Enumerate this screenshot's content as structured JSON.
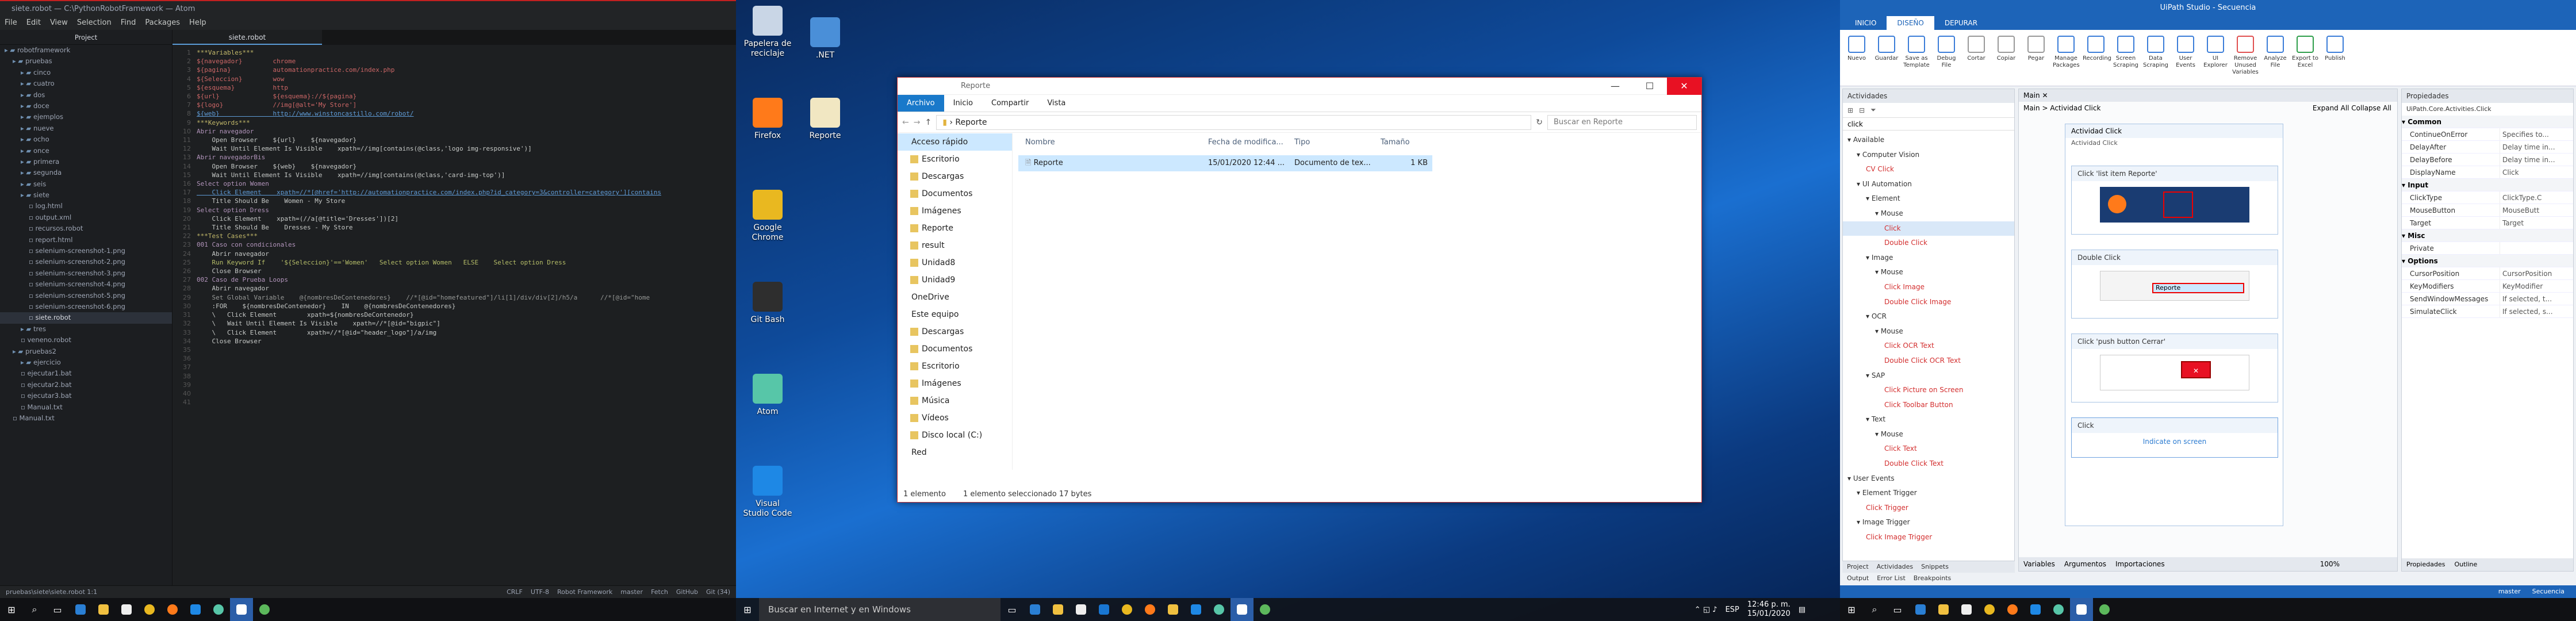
{
  "atom": {
    "title": "siete.robot — C:\\PythonRobotFramework — Atom",
    "menu": [
      "File",
      "Edit",
      "View",
      "Selection",
      "Find",
      "Packages",
      "Help"
    ],
    "project_header": "Project",
    "tab": "siete.robot",
    "tree": [
      {
        "t": "robotframework",
        "d": 0
      },
      {
        "t": "pruebas",
        "d": 1
      },
      {
        "t": "cinco",
        "d": 2
      },
      {
        "t": "cuatro",
        "d": 2
      },
      {
        "t": "dos",
        "d": 2
      },
      {
        "t": "doce",
        "d": 2
      },
      {
        "t": "ejemplos",
        "d": 2
      },
      {
        "t": "nueve",
        "d": 2
      },
      {
        "t": "ocho",
        "d": 2
      },
      {
        "t": "once",
        "d": 2
      },
      {
        "t": "primera",
        "d": 2
      },
      {
        "t": "segunda",
        "d": 2
      },
      {
        "t": "seis",
        "d": 2
      },
      {
        "t": "siete",
        "d": 2
      },
      {
        "t": "log.html",
        "d": 3
      },
      {
        "t": "output.xml",
        "d": 3
      },
      {
        "t": "recursos.robot",
        "d": 3
      },
      {
        "t": "report.html",
        "d": 3
      },
      {
        "t": "selenium-screenshot-1.png",
        "d": 3
      },
      {
        "t": "selenium-screenshot-2.png",
        "d": 3
      },
      {
        "t": "selenium-screenshot-3.png",
        "d": 3
      },
      {
        "t": "selenium-screenshot-4.png",
        "d": 3
      },
      {
        "t": "selenium-screenshot-5.png",
        "d": 3
      },
      {
        "t": "selenium-screenshot-6.png",
        "d": 3
      },
      {
        "t": "siete.robot",
        "d": 3,
        "sel": true
      },
      {
        "t": "tres",
        "d": 2
      },
      {
        "t": "veneno.robot",
        "d": 2
      },
      {
        "t": "pruebas2",
        "d": 1
      },
      {
        "t": "ejercicio",
        "d": 2
      },
      {
        "t": "ejecutar1.bat",
        "d": 2
      },
      {
        "t": "ejecutar2.bat",
        "d": 2
      },
      {
        "t": "ejecutar3.bat",
        "d": 2
      },
      {
        "t": "Manual.txt",
        "d": 2
      },
      {
        "t": "Manual.txt",
        "d": 1
      }
    ],
    "code": [
      [
        "sec",
        "***Variables***"
      ],
      [
        "var",
        "${navegador}        chrome"
      ],
      [
        "var",
        "${pagina}           automationpractice.com/index.php"
      ],
      [
        "var",
        "${Seleccion}        wow"
      ],
      [
        "var",
        "${esquema}          http"
      ],
      [
        "var",
        "${url}              ${esquema}://${pagina}"
      ],
      [
        "var",
        "${logo}             //img[@alt='My Store']"
      ],
      [
        "url",
        "${web}              http://www.winstoncastillo.com/robot/"
      ],
      [
        "",
        ""
      ],
      [
        "sec",
        "***Keywords***"
      ],
      [
        "kw",
        "Abrir navegador"
      ],
      [
        "",
        "    Open Browser    ${url}    ${navegador}"
      ],
      [
        "",
        "    Wait Until Element Is Visible    xpath=//img[contains(@class,'logo img-responsive')]"
      ],
      [
        "",
        ""
      ],
      [
        "kw",
        "Abrir navegadorBis"
      ],
      [
        "",
        "    Open Browser    ${web}    ${navegador}"
      ],
      [
        "",
        "    Wait Until Element Is Visible    xpath=//img[contains(@class,'card-img-top')]"
      ],
      [
        "",
        ""
      ],
      [
        "kw",
        "Select option Women"
      ],
      [
        "url",
        "    Click Element    xpath=//*[@href='http://automationpractice.com/index.php?id_category=3&controller=category'][contains"
      ],
      [
        "",
        "    Title Should Be    Women - My Store"
      ],
      [
        "",
        ""
      ],
      [
        "kw",
        "Select option Dress"
      ],
      [
        "",
        "    Click Element    xpath=(//a[@title='Dresses'])[2]"
      ],
      [
        "",
        "    Title Should Be    Dresses - My Store"
      ],
      [
        "",
        ""
      ],
      [
        "",
        ""
      ],
      [
        "sec",
        "***Test Cases***"
      ],
      [
        "kw",
        "001 Caso con condicionales"
      ],
      [
        "",
        "    Abrir navegador"
      ],
      [
        "str",
        "    Run Keyword If    '${Seleccion}'=='Women'   Select option Women   ELSE    Select option Dress"
      ],
      [
        "",
        "    Close Browser"
      ],
      [
        "",
        ""
      ],
      [
        "kw",
        "002 Caso de Prueba Loops"
      ],
      [
        "",
        "    Abrir navegador"
      ],
      [
        "cm",
        "    Set Global Variable    @{nombresDeContenedores}    //*[@id=\"homefeatured\"]/li[1]/div/div[2]/h5/a      //*[@id=\"home"
      ],
      [
        "",
        "    :FOR    ${nombresDeContenedor}    IN    @{nombresDeContenedores}"
      ],
      [
        "",
        "    \\   Click Element        xpath=${nombresDeContenedor}"
      ],
      [
        "",
        "    \\   Wait Until Element Is Visible    xpath=//*[@id=\"bigpic\"]"
      ],
      [
        "",
        "    \\   Click Element        xpath=//*[@id=\"header_logo\"]/a/img"
      ],
      [
        "",
        "    Close Browser"
      ]
    ],
    "status_left": "pruebas\\siete\\siete.robot   1:1",
    "status_right": [
      "CRLF",
      "UTF-8",
      "Robot Framework",
      "master",
      "Fetch",
      "GitHub",
      "Git (34)"
    ]
  },
  "desktop_icons": [
    {
      "label": "Papelera de reciclaje",
      "color": "#c9d6e6"
    },
    {
      "label": ".NET",
      "color": "#4a8fd8"
    },
    {
      "label": "Firefox",
      "color": "#ff7a1a"
    },
    {
      "label": "Reporte",
      "color": "#f1e7c2"
    },
    {
      "label": "Google Chrome",
      "color": "#e9b820"
    },
    {
      "label": "Git Bash",
      "color": "#2e2e2e"
    },
    {
      "label": "Atom",
      "color": "#57c6a8"
    },
    {
      "label": "Visual Studio Code",
      "color": "#1e88e5"
    }
  ],
  "explorer": {
    "title": "Reporte",
    "ribbon": [
      "Archivo",
      "Inicio",
      "Compartir",
      "Vista"
    ],
    "path": "Reporte",
    "search": "Buscar en Reporte",
    "nav": [
      {
        "t": "Acceso rápido",
        "h": true,
        "s": true
      },
      {
        "t": "Escritorio"
      },
      {
        "t": "Descargas"
      },
      {
        "t": "Documentos"
      },
      {
        "t": "Imágenes"
      },
      {
        "t": "Reporte"
      },
      {
        "t": "result"
      },
      {
        "t": "Unidad8"
      },
      {
        "t": "Unidad9"
      },
      {
        "t": "OneDrive",
        "h": true
      },
      {
        "t": "Este equipo",
        "h": true
      },
      {
        "t": "Descargas"
      },
      {
        "t": "Documentos"
      },
      {
        "t": "Escritorio"
      },
      {
        "t": "Imágenes"
      },
      {
        "t": "Música"
      },
      {
        "t": "Vídeos"
      },
      {
        "t": "Disco local (C:)"
      },
      {
        "t": "Red",
        "h": true
      }
    ],
    "columns": [
      "Nombre",
      "Fecha de modifica...",
      "Tipo",
      "Tamaño"
    ],
    "file": {
      "name": "Reporte",
      "date": "15/01/2020 12:44 ...",
      "type": "Documento de tex...",
      "size": "1 KB"
    },
    "status": [
      "1 elemento",
      "1 elemento seleccionado  17 bytes"
    ]
  },
  "taskbar2": {
    "search": "Buscar en Internet y en Windows",
    "lang": "ESP",
    "time": "12:46 p. m.",
    "date": "15/01/2020"
  },
  "uipath": {
    "title": "UiPath Studio - Secuencia",
    "tabs": [
      "INICIO",
      "DISEÑO",
      "DEPURAR"
    ],
    "ribbon": [
      "Nuevo",
      "Guardar",
      "Save as Template",
      "Debug File",
      "Cortar",
      "Copiar",
      "Pegar",
      "Manage Packages",
      "Recording",
      "Screen Scraping",
      "Data Scraping",
      "User Events",
      "UI Explorer",
      "Remove Unused Variables",
      "Analyze File",
      "Export to Excel",
      "Publish"
    ],
    "activities_header": "Actividades",
    "search": "click",
    "activities": [
      {
        "t": "Available",
        "d": 0
      },
      {
        "t": "Computer Vision",
        "d": 1
      },
      {
        "t": "CV Click",
        "d": 2,
        "r": true
      },
      {
        "t": "UI Automation",
        "d": 1
      },
      {
        "t": "Element",
        "d": 2
      },
      {
        "t": "Mouse",
        "d": 3
      },
      {
        "t": "Click",
        "d": 4,
        "r": true,
        "sel": true
      },
      {
        "t": "Double Click",
        "d": 4,
        "r": true
      },
      {
        "t": "Image",
        "d": 2
      },
      {
        "t": "Mouse",
        "d": 3
      },
      {
        "t": "Click Image",
        "d": 4,
        "r": true
      },
      {
        "t": "Double Click Image",
        "d": 4,
        "r": true
      },
      {
        "t": "OCR",
        "d": 2
      },
      {
        "t": "Mouse",
        "d": 3
      },
      {
        "t": "Click OCR Text",
        "d": 4,
        "r": true
      },
      {
        "t": "Double Click OCR Text",
        "d": 4,
        "r": true
      },
      {
        "t": "SAP",
        "d": 2
      },
      {
        "t": "Click Picture on Screen",
        "d": 4,
        "r": true
      },
      {
        "t": "Click Toolbar Button",
        "d": 4,
        "r": true
      },
      {
        "t": "Text",
        "d": 2
      },
      {
        "t": "Mouse",
        "d": 3
      },
      {
        "t": "Click Text",
        "d": 4,
        "r": true
      },
      {
        "t": "Double Click Text",
        "d": 4,
        "r": true
      },
      {
        "t": "User Events",
        "d": 0
      },
      {
        "t": "Element Trigger",
        "d": 1
      },
      {
        "t": "Click Trigger",
        "d": 2,
        "r": true
      },
      {
        "t": "Image Trigger",
        "d": 1
      },
      {
        "t": "Click Image Trigger",
        "d": 2,
        "r": true
      }
    ],
    "left_bottom_tabs": [
      "Project",
      "Actividades",
      "Snippets"
    ],
    "bottom_tabs": [
      "Output",
      "Error List",
      "Breakpoints"
    ],
    "designer_tab": "Main",
    "breadcrumb": "Main  >  Actividad Click",
    "expand": "Expand All   Collapse All",
    "seq_title": "Actividad Click",
    "seq_sub": "Actividad Click",
    "cards": [
      {
        "title": "Click 'list item  Reporte'"
      },
      {
        "title": "Double Click",
        "label": "Reporte"
      },
      {
        "title": "Click 'push button  Cerrar'"
      },
      {
        "title": "Click",
        "hint": "Indicate on screen"
      }
    ],
    "designer_bottom": [
      "Variables",
      "Argumentos",
      "Importaciones"
    ],
    "zoom": "100%",
    "props_header": "Propiedades",
    "props_class": "UiPath.Core.Activities.Click",
    "props": [
      {
        "g": "Common"
      },
      {
        "k": "ContinueOnError",
        "v": "Specifies to..."
      },
      {
        "k": "DelayAfter",
        "v": "Delay time in..."
      },
      {
        "k": "DelayBefore",
        "v": "Delay time in..."
      },
      {
        "k": "DisplayName",
        "v": "Click"
      },
      {
        "g": "Input"
      },
      {
        "k": "ClickType",
        "v": "ClickType.C"
      },
      {
        "k": "MouseButton",
        "v": "MouseButt"
      },
      {
        "k": "Target",
        "v": "Target"
      },
      {
        "g": "Misc"
      },
      {
        "k": "Private",
        "v": ""
      },
      {
        "g": "Options"
      },
      {
        "k": "CursorPosition",
        "v": "CursorPosition"
      },
      {
        "k": "KeyModifiers",
        "v": "KeyModifier"
      },
      {
        "k": "SendWindowMessages",
        "v": "If selected, t..."
      },
      {
        "k": "SimulateClick",
        "v": "If selected, s..."
      }
    ],
    "props_tabs": [
      "Propiedades",
      "Outline"
    ],
    "status": [
      "master",
      "Secuencia"
    ]
  }
}
